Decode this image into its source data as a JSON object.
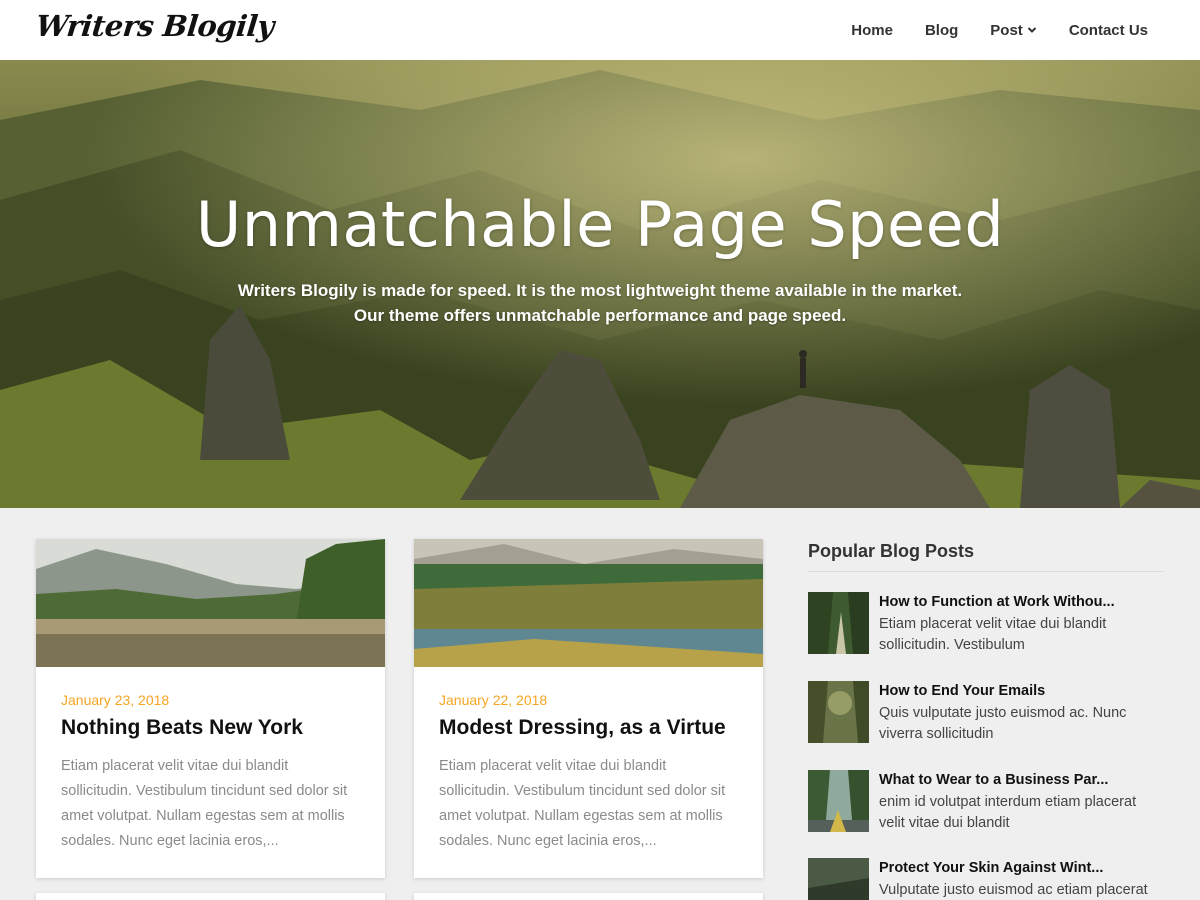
{
  "site": {
    "logo": "Writers Blogily"
  },
  "nav": {
    "items": [
      {
        "label": "Home"
      },
      {
        "label": "Blog"
      },
      {
        "label": "Post",
        "icon": "chevron-down-icon"
      },
      {
        "label": "Contact Us"
      }
    ]
  },
  "hero": {
    "title": "Unmatchable Page Speed",
    "subtitle_line1": "Writers Blogily is made for speed. It is the most lightweight theme available in the market.",
    "subtitle_line2": "Our theme offers unmatchable performance and page speed."
  },
  "posts": [
    {
      "date": "January 23, 2018",
      "title": "Nothing Beats New York",
      "excerpt": "Etiam placerat velit vitae dui blandit sollicitudin. Vestibulum tincidunt sed dolor sit amet volutpat. Nullam egestas sem at mollis sodales. Nunc eget lacinia eros,..."
    },
    {
      "date": "January 22, 2018",
      "title": "Modest Dressing, as a Virtue",
      "excerpt": "Etiam placerat velit vitae dui blandit sollicitudin. Vestibulum tincidunt sed dolor sit amet volutpat. Nullam egestas sem at mollis sodales. Nunc eget lacinia eros,..."
    }
  ],
  "sidebar": {
    "title": "Popular Blog Posts",
    "items": [
      {
        "title": "How to Function at Work Withou...",
        "excerpt": "Etiam placerat velit vitae dui blandit sollicitudin. Vestibulum"
      },
      {
        "title": "How to End Your Emails",
        "excerpt": "Quis vulputate justo euismod ac. Nunc viverra sollicitudin"
      },
      {
        "title": "What to Wear to a Business Par...",
        "excerpt": "enim id volutpat interdum etiam placerat velit vitae dui blandit"
      },
      {
        "title": "Protect Your Skin Against Wint...",
        "excerpt": "Vulputate justo euismod ac etiam placerat"
      }
    ]
  },
  "colors": {
    "accent_date": "#f5a524",
    "background": "#efefef"
  }
}
